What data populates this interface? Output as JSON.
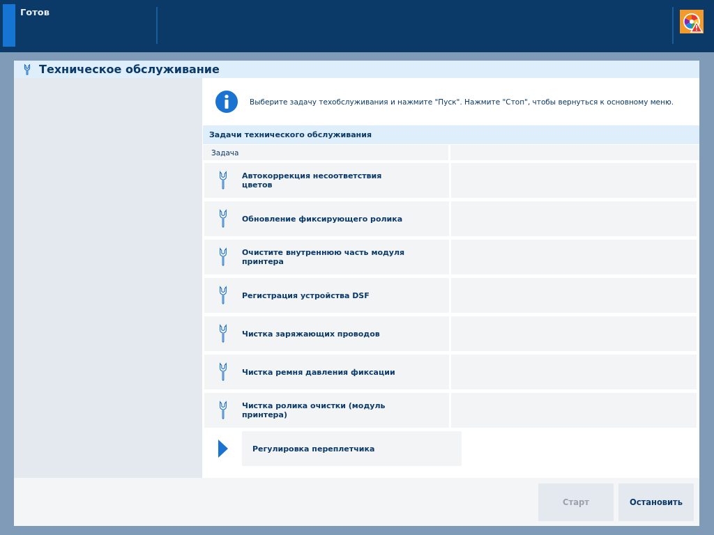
{
  "status_bar": {
    "status": "Готов"
  },
  "dialog": {
    "title": "Техническое обслуживание",
    "info": "Выберите задачу техобслуживания и нажмите \"Пуск\". Нажмите \"Стоп\", чтобы вернуться к основному меню.",
    "section_title": "Задачи технического обслуживания",
    "columns": [
      "Задача"
    ],
    "tasks": [
      {
        "name": "Автокоррекция несоответствия цветов",
        "selected": false
      },
      {
        "name": "Обновление фиксирующего ролика",
        "selected": false
      },
      {
        "name": "Очистите внутреннюю часть модуля принтера",
        "selected": false
      },
      {
        "name": "Регистрация устройства DSF",
        "selected": false
      },
      {
        "name": "Чистка заряжающих проводов",
        "selected": false
      },
      {
        "name": "Чистка ремня давления фиксации",
        "selected": false
      },
      {
        "name": "Чистка ролика очистки (модуль принтера)",
        "selected": false
      },
      {
        "name": "Регулировка переплетчика",
        "selected": true
      }
    ],
    "buttons": [
      {
        "label": "Старт",
        "disabled": true
      },
      {
        "label": "Остановить",
        "disabled": false
      }
    ]
  }
}
